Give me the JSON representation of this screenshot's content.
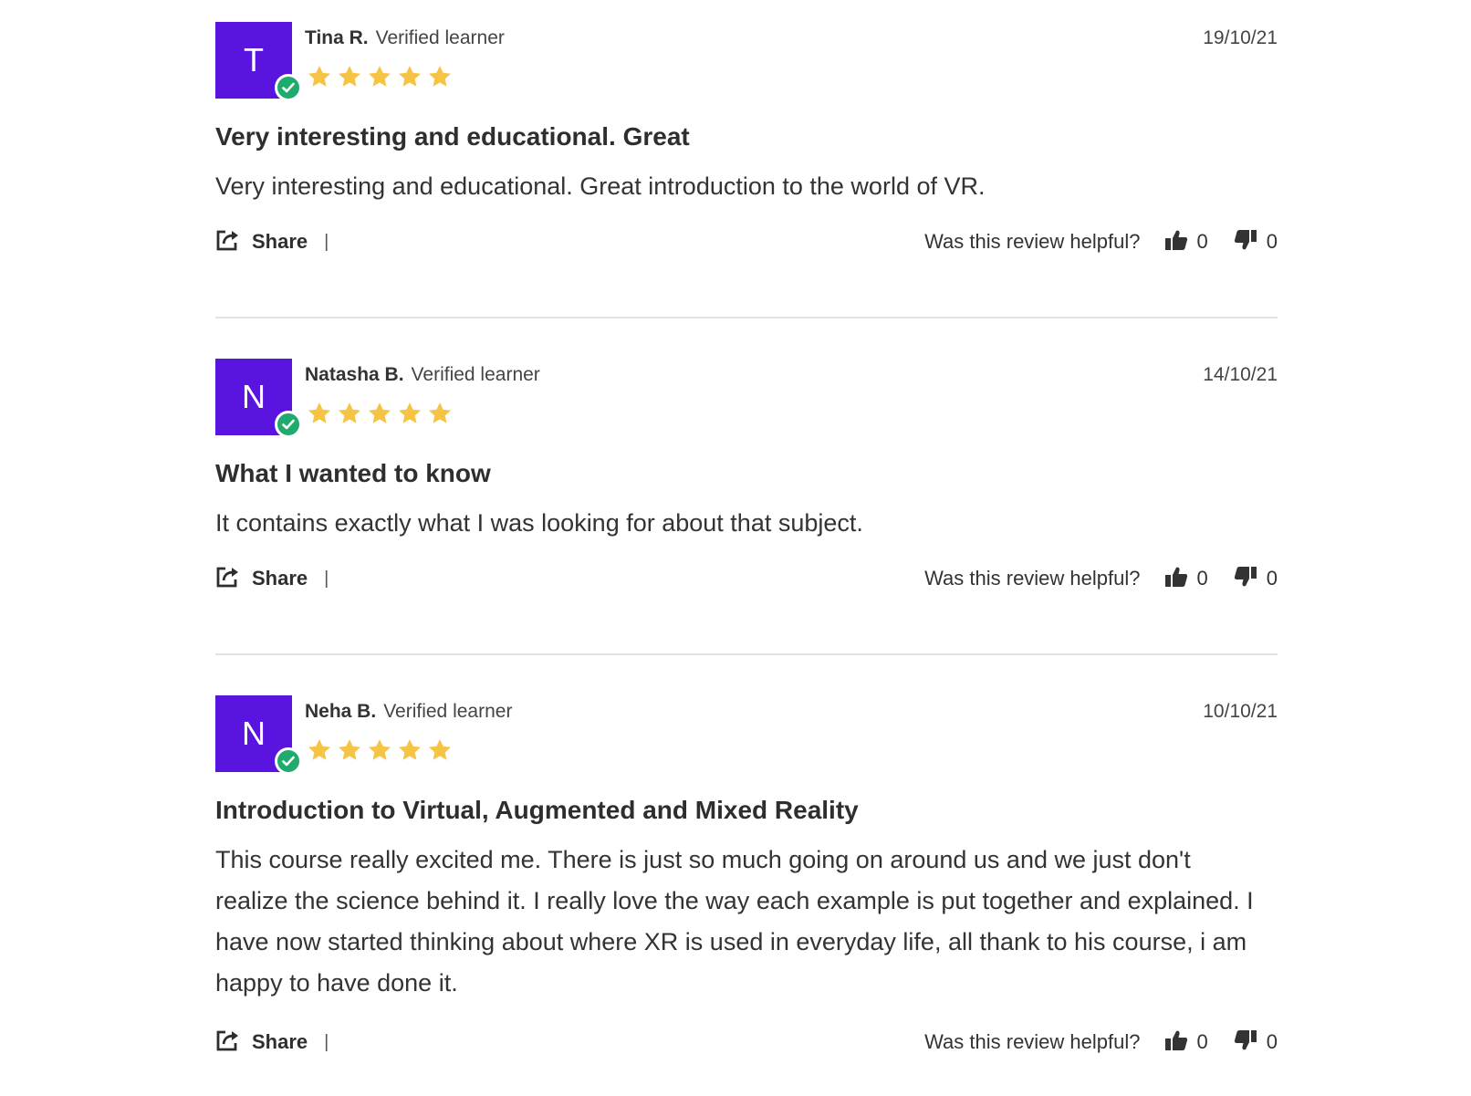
{
  "colors": {
    "avatar_bg": "#5a14e0",
    "verified_badge": "#1faa6e",
    "star": "#f6c445",
    "divider": "#e3e3e3"
  },
  "icons": {
    "share": "share-icon",
    "thumbs_up": "thumbs-up-icon",
    "thumbs_down": "thumbs-down-icon",
    "verified": "checkmark-icon",
    "star": "star-icon"
  },
  "reviews": [
    {
      "initial": "T",
      "name": "Tina R.",
      "verified_label": "Verified learner",
      "date": "19/10/21",
      "rating": 5,
      "title": "Very interesting and educational. Great",
      "body": "Very interesting and educational. Great introduction to the world of VR.",
      "share_label": "Share",
      "separator": "|",
      "helpful_question": "Was this review helpful?",
      "helpful_up": "0",
      "helpful_down": "0"
    },
    {
      "initial": "N",
      "name": "Natasha B.",
      "verified_label": "Verified learner",
      "date": "14/10/21",
      "rating": 5,
      "title": "What I wanted to know",
      "body": "It contains exactly what I was looking for about that subject.",
      "share_label": "Share",
      "separator": "|",
      "helpful_question": "Was this review helpful?",
      "helpful_up": "0",
      "helpful_down": "0"
    },
    {
      "initial": "N",
      "name": "Neha B.",
      "verified_label": "Verified learner",
      "date": "10/10/21",
      "rating": 5,
      "title": "Introduction to Virtual, Augmented and Mixed Reality",
      "body": "This course really excited me. There is just so much going on around us and we just don't realize the science behind it. I really love the way each example is put together and explained. I have now started thinking about where XR is used in everyday life, all thank to his course, i am happy to have done it.",
      "share_label": "Share",
      "separator": "|",
      "helpful_question": "Was this review helpful?",
      "helpful_up": "0",
      "helpful_down": "0"
    }
  ]
}
